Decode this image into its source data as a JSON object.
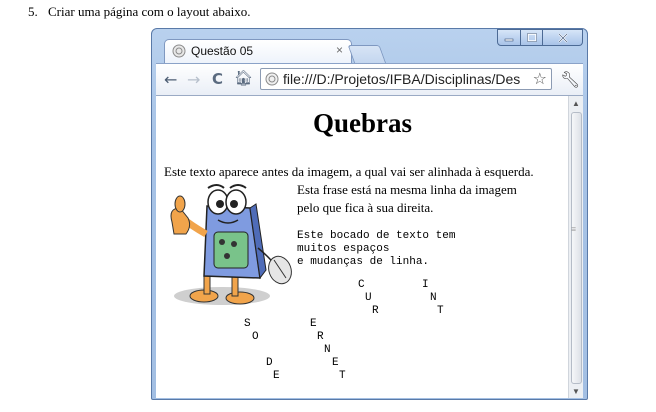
{
  "question": {
    "number": "5.",
    "text": "Criar uma página com o layout abaixo."
  },
  "browser": {
    "tab_title": "Questão 05",
    "tab_close": "×",
    "url": "file:///D:/Projetos/IFBA/Disciplinas/Des",
    "window_controls": {
      "minimize": "minimize-icon",
      "maximize": "maximize-icon",
      "close": "close-icon"
    }
  },
  "page": {
    "heading": "Quebras",
    "intro": "Este texto aparece antes da imagem, a qual vai ser alinhada à esquerda.",
    "side_line1": "Esta frase está na mesma linha da imagem",
    "side_line2": "pelo que fica à sua direita.",
    "pre_lines": [
      "Este bocado de texto tem",
      "muitos espaços",
      "e mudanças de linha."
    ],
    "scattered_letters": [
      "C",
      "I",
      "U",
      "N",
      "R",
      "T",
      "S",
      "E",
      "O",
      "R",
      "N",
      "D",
      "E",
      "E",
      "T"
    ]
  },
  "icons": {
    "back": "back-arrow-icon",
    "forward": "forward-arrow-icon",
    "reload": "reload-icon",
    "home": "home-icon",
    "bookmark": "star-icon",
    "menu": "wrench-icon"
  }
}
